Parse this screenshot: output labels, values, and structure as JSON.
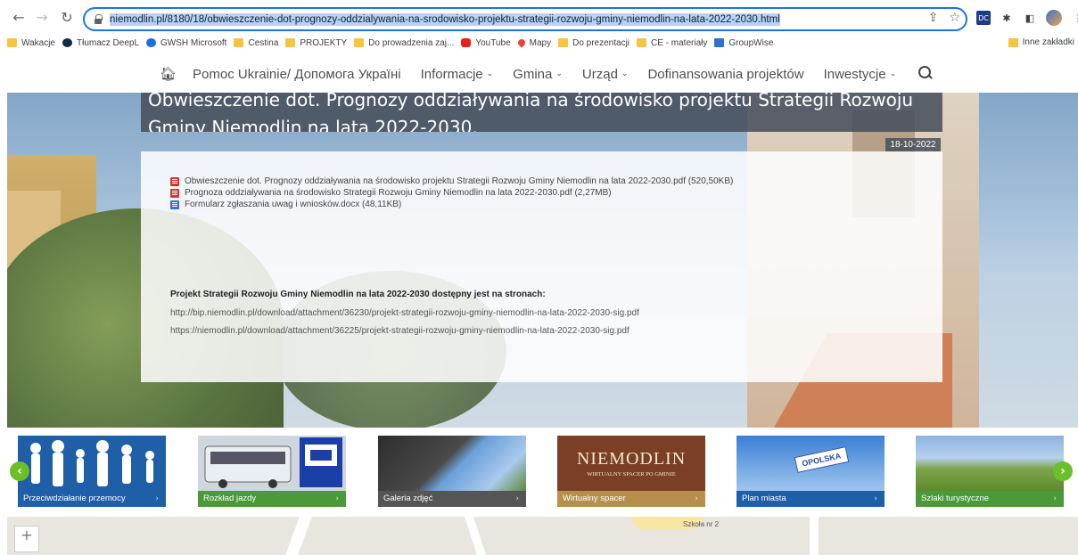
{
  "browser": {
    "url": "niemodlin.pl/8180/18/obwieszczenie-dot-prognozy-oddzialywania-na-srodowisko-projektu-strategii-rozwoju-gminy-niemodlin-na-lata-2022-2030.html",
    "ext_label": "DC"
  },
  "bookmarks": {
    "items": [
      "Wakacje",
      "Tłumacz DeepL",
      "GWSH Microsoft",
      "Cestina",
      "PROJEKTY",
      "Do prowadzenia zaj...",
      "YouTube",
      "Mapy",
      "Do prezentacji",
      "CE - materiały",
      "GroupWise"
    ],
    "other": "Inne zakładki"
  },
  "nav": {
    "items": [
      {
        "label": "Pomoc Ukrainie/ Допомога Україні",
        "dropdown": false
      },
      {
        "label": "Informacje",
        "dropdown": true
      },
      {
        "label": "Gmina",
        "dropdown": true
      },
      {
        "label": "Urząd",
        "dropdown": true
      },
      {
        "label": "Dofinansowania projektów",
        "dropdown": false
      },
      {
        "label": "Inwestycje",
        "dropdown": true
      }
    ]
  },
  "article": {
    "title": "Obwieszczenie dot. Prognozy oddziaływania na środowisko projektu Strategii Rozwoju Gminy Niemodlin na lata 2022-2030.",
    "date": "18-10-2022",
    "files": [
      {
        "type": "pdf",
        "label": "Obwieszczenie dot. Prognozy oddziaływania na środowisko projektu Strategii Rozwoju Gminy Niemodlin na lata 2022-2030.pdf (520,50KB)"
      },
      {
        "type": "pdf",
        "label": "Prognoza oddziaływania na środowisko Strategii Rozwoju Gminy Niemodlin na lata 2022-2030.pdf (2,27MB)"
      },
      {
        "type": "doc",
        "label": "Formularz zgłaszania uwag i wniosków.docx (48,11KB)"
      }
    ],
    "project_heading": "Projekt Strategii Rozwoju Gminy Niemodlin na lata 2022-2030 dostępny jest na stronach:",
    "links": [
      "http://bip.niemodlin.pl/download/attachment/36230/projekt-strategii-rozwoju-gminy-niemodlin-na-lata-2022-2030-sig.pdf",
      "https://niemodlin.pl/download/attachment/36225/projekt-strategii-rozwoju-gminy-niemodlin-na-lata-2022-2030-sig.pdf"
    ]
  },
  "tiles": [
    {
      "label": "Przeciwdziałanie przemocy",
      "color": "#1f5fa8"
    },
    {
      "label": "Rozkład jazdy",
      "color": "#4a9a3a"
    },
    {
      "label": "Galeria zdjęć",
      "color": "#555555"
    },
    {
      "label": "Wirtualny spacer",
      "color": "#b58f4b"
    },
    {
      "label": "Plan miasta",
      "color": "#1f5fa8"
    },
    {
      "label": "Szlaki turystyczne",
      "color": "#4a9a3a"
    }
  ],
  "tile_art": {
    "niemodlin": "NIEMODLIN",
    "niemodlin_sub": "WIRTUALNY SPACER PO GMINIE",
    "opolska": "OPOLSKA"
  },
  "map": {
    "label": "Szkoła nr 2",
    "zoom_in": "+"
  }
}
